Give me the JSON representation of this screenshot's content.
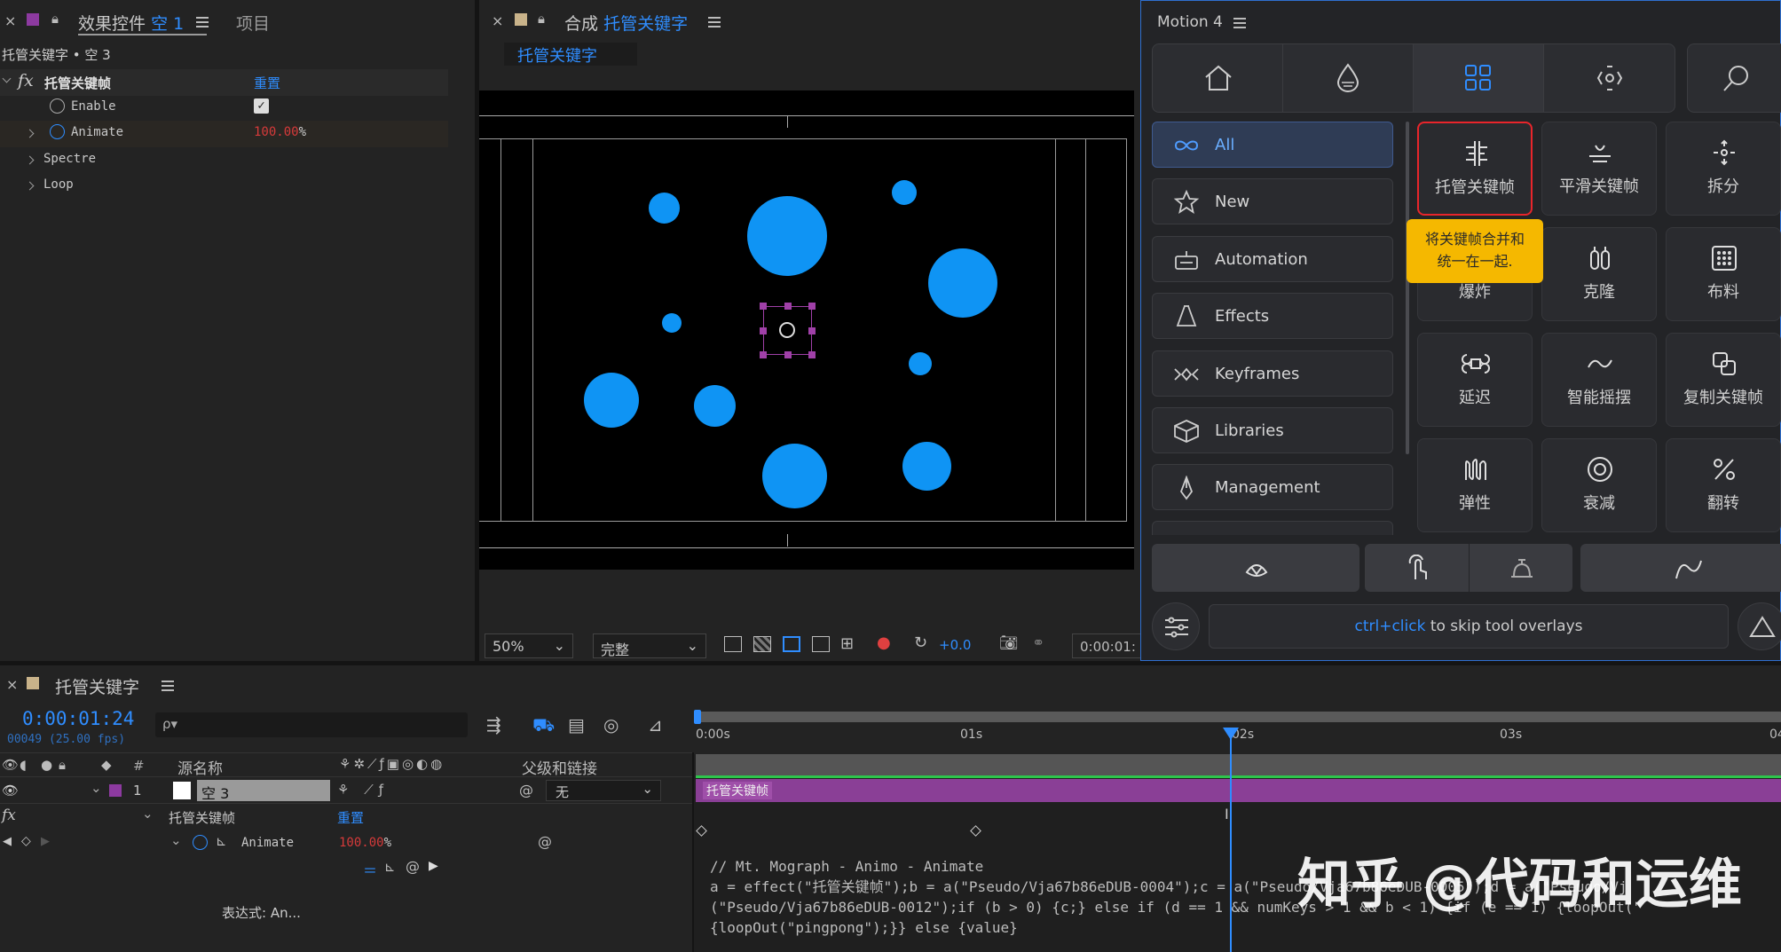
{
  "effect_panel": {
    "tab_label": "效果控件",
    "tab_layer": "空 1",
    "tab_project": "项目",
    "breadcrumb": "托管关键字 • 空 3",
    "fx_label": "fx",
    "effect_name": "托管关键帧",
    "reset_label": "重置",
    "props": [
      {
        "name": "Enable",
        "checked": true
      },
      {
        "name": "Animate",
        "value": "100.00",
        "unit": "%"
      },
      {
        "name": "Spectre"
      },
      {
        "name": "Loop"
      }
    ]
  },
  "comp_panel": {
    "tab_prefix": "合成",
    "tab_name": "托管关键字",
    "sub_tab": "托管关键字",
    "zoom": "50%",
    "quality": "完整",
    "exposure": "+0.0",
    "timecode": "0:00:01:"
  },
  "motion": {
    "title": "Motion 4",
    "categories": [
      {
        "label": "All",
        "icon": "infinity-icon",
        "active": true
      },
      {
        "label": "New",
        "icon": "star-icon"
      },
      {
        "label": "Automation",
        "icon": "robot-icon"
      },
      {
        "label": "Effects",
        "icon": "flask-icon"
      },
      {
        "label": "Keyframes",
        "icon": "keyframes-icon"
      },
      {
        "label": "Libraries",
        "icon": "cube-icon"
      },
      {
        "label": "Management",
        "icon": "pen-nib-icon"
      }
    ],
    "tools": [
      {
        "label": "托管关键帧",
        "icon": "host-keyframe-icon"
      },
      {
        "label": "平滑关键帧",
        "icon": "smooth-icon"
      },
      {
        "label": "拆分",
        "icon": "split-icon"
      },
      {
        "label": "爆炸",
        "icon": "explode-icon"
      },
      {
        "label": "克隆",
        "icon": "clone-icon"
      },
      {
        "label": "布料",
        "icon": "cloth-icon"
      },
      {
        "label": "延迟",
        "icon": "command-icon"
      },
      {
        "label": "智能摇摆",
        "icon": "wiggle-icon"
      },
      {
        "label": "复制关键帧",
        "icon": "copy-icon"
      },
      {
        "label": "弹性",
        "icon": "elastic-icon"
      },
      {
        "label": "衰减",
        "icon": "target-icon"
      },
      {
        "label": "翻转",
        "icon": "percent-icon"
      }
    ],
    "tooltip_line1": "将关键帧合并和",
    "tooltip_line2": "统一在一起.",
    "hint_key": "ctrl+click",
    "hint_rest": " to skip tool overlays"
  },
  "timeline": {
    "tab_name": "托管关键字",
    "timecode": "0:00:01:24",
    "frame_info": "00049 (25.00 fps)",
    "search_placeholder": "ρ▾",
    "col_num": "#",
    "col_source": "源名称",
    "col_parent": "父级和链接",
    "layer_index": "1",
    "layer_name": "空 3",
    "parent_value": "无",
    "effect_name": "托管关键帧",
    "reset_label": "重置",
    "prop_name": "Animate",
    "prop_value": "100.00",
    "prop_unit": "%",
    "expr_label": "表达式: An...",
    "bar_label": "托管关键帧",
    "ticks": [
      "0:00s",
      "01s",
      "02s",
      "03s",
      "04"
    ],
    "code_line1": "// Mt. Mograph - Animo - Animate",
    "code_line2": "a = effect(\"托管关键帧\");b = a(\"Pseudo/Vja67b86eDUB-0004\");c = a(\"Pseudo/Vja67b86eDUB-0005\");d = a(\"Pseudo/Vj",
    "code_line3": "(\"Pseudo/Vja67b86eDUB-0012\");if (b > 0) {c;} else if (d == 1 && numKeys > 1 && b < 1) {if (e == 1) {loopOut(\"",
    "code_line4": "{loopOut(\"pingpong\");}} else {value}"
  },
  "watermark": "知乎 @代码和运维",
  "colors": {
    "accent": "#2f8dff",
    "circle": "#0f94f4",
    "layer_bar": "#8a3f96",
    "tooltip": "#f5b800"
  }
}
